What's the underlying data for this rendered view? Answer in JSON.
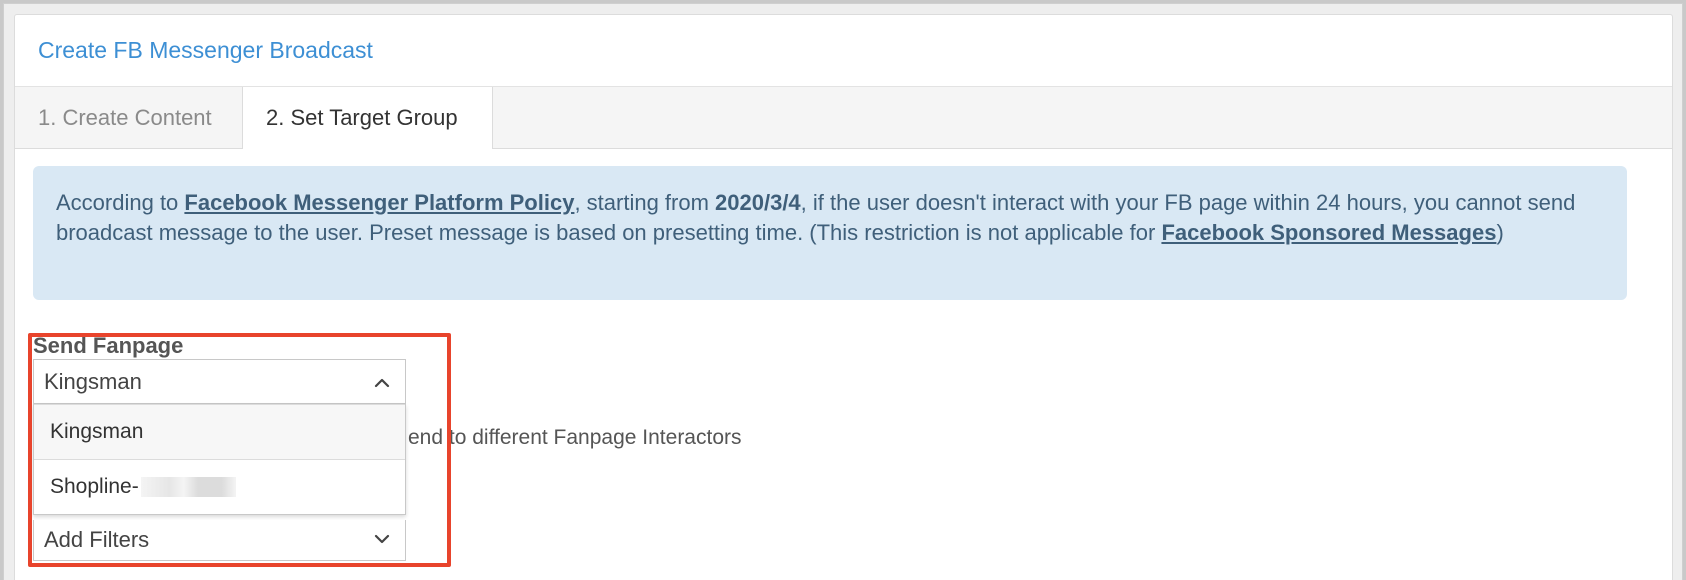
{
  "header": {
    "title": "Create FB Messenger Broadcast"
  },
  "tabs": [
    {
      "label": "1. Create Content",
      "active": false
    },
    {
      "label": "2. Set Target Group",
      "active": true
    }
  ],
  "notice": {
    "text_1": "According to ",
    "link_policy": "Facebook Messenger Platform Policy",
    "text_2": ", starting from ",
    "date": "2020/3/4",
    "text_3": ", if the user doesn't interact with your FB page within 24 hours, you cannot send broadcast message to the user. Preset message is based on presetting time. (This restriction is not applicable for ",
    "link_sponsored": "Facebook Sponsored Messages",
    "text_4": ")"
  },
  "fanpage": {
    "label": "Send Fanpage",
    "selected": "Kingsman",
    "options": [
      "Kingsman",
      "Shopline-"
    ],
    "hint": "end to different Fanpage Interactors"
  },
  "filters": {
    "placeholder": "Add Filters"
  },
  "colors": {
    "accent": "#3d8fd4",
    "notice_bg": "#d9e8f4",
    "highlight": "#e8442c"
  }
}
